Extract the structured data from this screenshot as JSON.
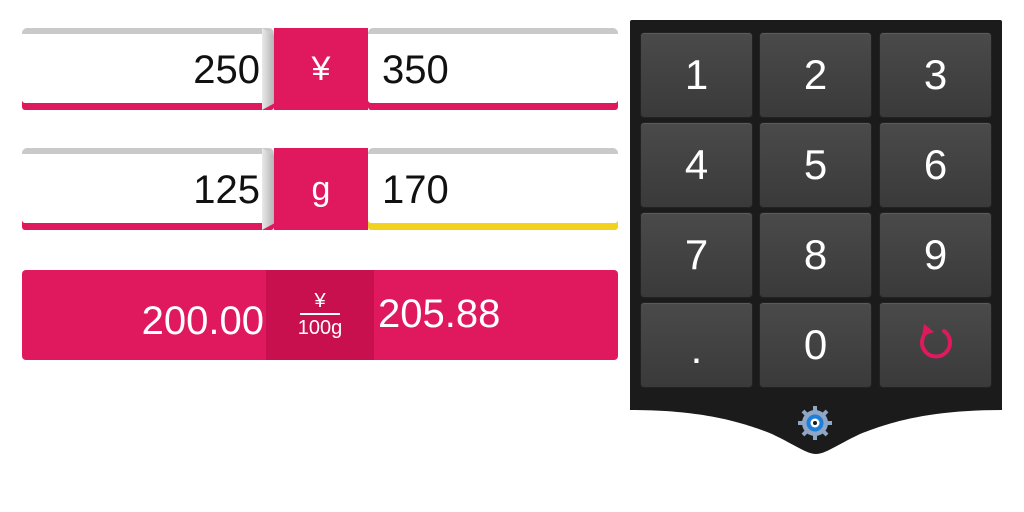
{
  "row1": {
    "left_value": "250",
    "unit": "¥",
    "right_value": "350"
  },
  "row2": {
    "left_value": "125",
    "unit": "g",
    "right_value": "170"
  },
  "result": {
    "left_value": "200.00",
    "unit_num": "¥",
    "unit_den": "100g",
    "right_value": "205.88"
  },
  "keypad": {
    "keys": [
      "1",
      "2",
      "3",
      "4",
      "5",
      "6",
      "7",
      "8",
      "9",
      ".",
      "0"
    ],
    "reset_icon": "reset-icon",
    "settings_icon": "gear-icon"
  },
  "colors": {
    "accent": "#e0195f",
    "highlight": "#f2d21c",
    "keypad_bg": "#1b1b1b",
    "key_bg": "#424242"
  }
}
